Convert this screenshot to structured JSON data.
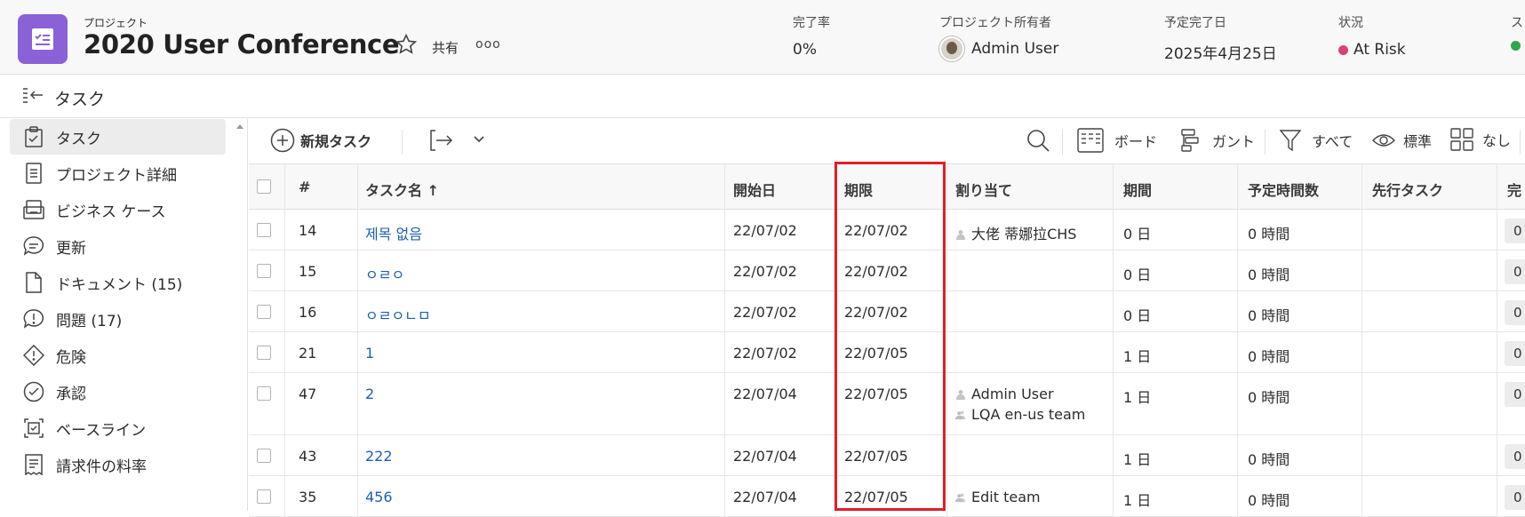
{
  "header": {
    "project_label": "プロジェクト",
    "title": "2020 User Conference",
    "share_label": "共有",
    "more_label": "ooo",
    "meta": [
      {
        "label": "完了率",
        "value": "0%"
      },
      {
        "label": "プロジェクト所有者",
        "value": "Admin User"
      },
      {
        "label": "予定完了日",
        "value": "2025年4月25日"
      },
      {
        "label": "状況",
        "value": "At Risk",
        "dot_color": "#d9417b"
      },
      {
        "label": "ス",
        "dot_color": "#2ba84a"
      }
    ]
  },
  "subbar": {
    "title": "タスク"
  },
  "sidebar": {
    "items": [
      {
        "label": "タスク",
        "icon": "clipboard-check-icon",
        "active": true
      },
      {
        "label": "プロジェクト詳細",
        "icon": "document-lines-icon"
      },
      {
        "label": "ビジネス ケース",
        "icon": "business-case-icon"
      },
      {
        "label": "更新",
        "icon": "speech-bubble-icon"
      },
      {
        "label": "ドキュメント (15)",
        "icon": "file-icon"
      },
      {
        "label": "問題 (17)",
        "icon": "issue-bubble-icon"
      },
      {
        "label": "危険",
        "icon": "risk-diamond-icon"
      },
      {
        "label": "承認",
        "icon": "approval-check-icon"
      },
      {
        "label": "ベースライン",
        "icon": "baseline-icon"
      },
      {
        "label": "請求件の料率",
        "icon": "billing-rate-icon"
      }
    ]
  },
  "toolbar": {
    "new_task": "新規タスク",
    "board": "ボード",
    "gantt": "ガント",
    "filter": "すべて",
    "view": "標準",
    "group": "なし"
  },
  "table": {
    "columns": [
      "#",
      "タスク名 ↑",
      "開始日",
      "期限",
      "割り当て",
      "期間",
      "予定時間数",
      "先行タスク",
      "完"
    ],
    "rows": [
      {
        "num": "14",
        "name": "제목 없음",
        "start": "22/07/02",
        "due": "22/07/02",
        "assign": [
          {
            "text": "大佬 蒂娜拉CHS",
            "icon": "user-icon"
          }
        ],
        "duration": "0 日",
        "hours": "0 時間",
        "pct": "0"
      },
      {
        "num": "15",
        "name": "ㅇㄹㅇ",
        "start": "22/07/02",
        "due": "22/07/02",
        "assign": [],
        "duration": "0 日",
        "hours": "0 時間",
        "pct": "0"
      },
      {
        "num": "16",
        "name": "ㅇㄹㅇㄴㅁ",
        "start": "22/07/02",
        "due": "22/07/02",
        "assign": [],
        "duration": "0 日",
        "hours": "0 時間",
        "pct": "0"
      },
      {
        "num": "21",
        "name": "1",
        "start": "22/07/02",
        "due": "22/07/05",
        "assign": [],
        "duration": "1 日",
        "hours": "0 時間",
        "pct": "0"
      },
      {
        "num": "47",
        "name": "2",
        "start": "22/07/04",
        "due": "22/07/05",
        "assign": [
          {
            "text": "Admin User",
            "icon": "user-icon"
          },
          {
            "text": "LQA en-us team",
            "icon": "team-icon"
          }
        ],
        "duration": "1 日",
        "hours": "0 時間",
        "pct": "0"
      },
      {
        "num": "43",
        "name": "222",
        "start": "22/07/04",
        "due": "22/07/05",
        "assign": [],
        "duration": "1 日",
        "hours": "0 時間",
        "pct": "0"
      },
      {
        "num": "35",
        "name": "456",
        "start": "22/07/04",
        "due": "22/07/05",
        "assign": [
          {
            "text": "Edit team",
            "icon": "team-icon"
          }
        ],
        "duration": "1 日",
        "hours": "0 時間",
        "pct": "0"
      }
    ]
  },
  "colors": {
    "accent": "#8b61d8",
    "link": "#1d5fb2",
    "highlight": "#e01e26"
  }
}
